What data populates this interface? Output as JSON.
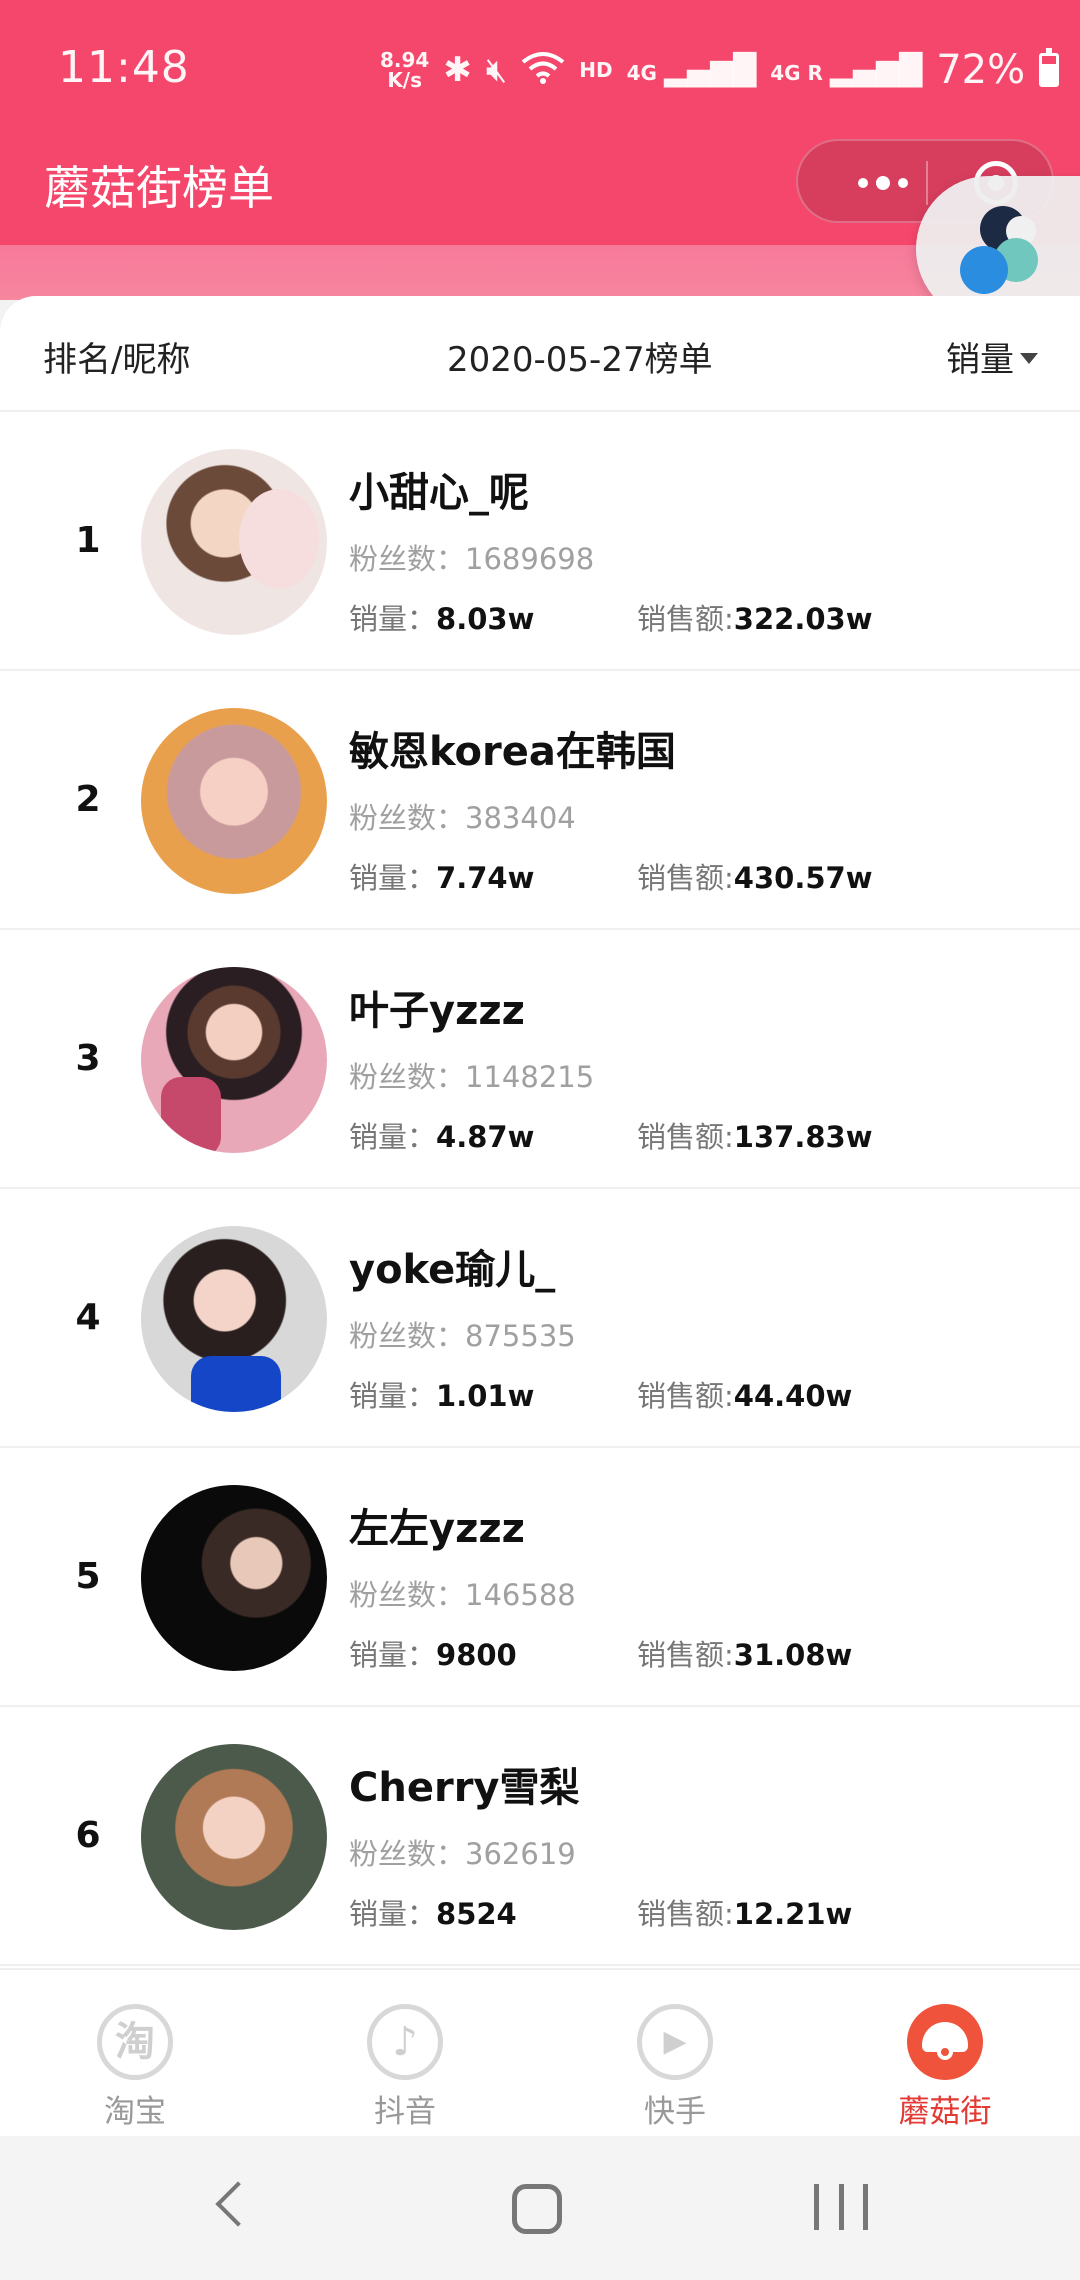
{
  "status_bar": {
    "time": "11:48",
    "net_speed_value": "8.94",
    "net_speed_unit": "K/s",
    "hd": "HD",
    "sim1": "4G",
    "sim2": "4G R",
    "battery": "72%"
  },
  "app": {
    "title": "蘑菇街榜单"
  },
  "list_header": {
    "left": "排名/昵称",
    "center": "2020-05-27榜单",
    "right": "销量"
  },
  "labels": {
    "fans": "粉丝数：",
    "sales": "销量：",
    "amount": "销售额:"
  },
  "rows": [
    {
      "rank": "1",
      "name": "小甜心_呢",
      "fans": "1689698",
      "sales": "8.03w",
      "amount": "322.03w"
    },
    {
      "rank": "2",
      "name": "敏恩korea在韩国",
      "fans": "383404",
      "sales": "7.74w",
      "amount": "430.57w"
    },
    {
      "rank": "3",
      "name": "叶子yzzz",
      "fans": "1148215",
      "sales": "4.87w",
      "amount": "137.83w"
    },
    {
      "rank": "4",
      "name": "yoke瑜儿_",
      "fans": "875535",
      "sales": "1.01w",
      "amount": "44.40w"
    },
    {
      "rank": "5",
      "name": "左左yzzz",
      "fans": "146588",
      "sales": "9800",
      "amount": "31.08w"
    },
    {
      "rank": "6",
      "name": "Cherry雪梨",
      "fans": "362619",
      "sales": "8524",
      "amount": "12.21w"
    }
  ],
  "tabs": [
    {
      "label": "淘宝",
      "glyph": "淘",
      "icon": "taobao-icon"
    },
    {
      "label": "抖音",
      "glyph": "♪",
      "icon": "douyin-icon"
    },
    {
      "label": "快手",
      "glyph": "▶",
      "icon": "kuaishou-icon"
    },
    {
      "label": "蘑菇街",
      "glyph": "",
      "icon": "mogujie-icon",
      "active": true
    }
  ],
  "colors": {
    "brand": "#f5476c",
    "active_tab": "#e33a34"
  }
}
